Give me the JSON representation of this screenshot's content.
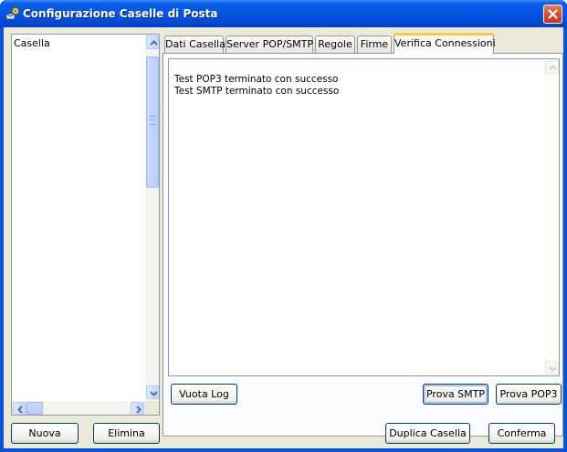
{
  "window": {
    "title": "Configurazione Caselle di Posta"
  },
  "list": {
    "header": "Casella"
  },
  "tabs": [
    {
      "label": "Dati Casella"
    },
    {
      "label": "Server POP/SMTP"
    },
    {
      "label": "Regole"
    },
    {
      "label": "Firme"
    },
    {
      "label": "Verifica Connessioni",
      "active": true
    }
  ],
  "log": {
    "lines": [
      "Test POP3 terminato con successo",
      "Test SMTP terminato con successo"
    ]
  },
  "panel_buttons": {
    "clear_log": "Vuota Log",
    "test_smtp": "Prova SMTP",
    "test_pop3": "Prova POP3"
  },
  "footer_buttons": {
    "new": "Nuova",
    "delete": "Elimina",
    "duplicate": "Duplica Casella",
    "confirm": "Conferma"
  },
  "icons": {
    "app": "mailbox-config-icon",
    "close": "close-icon"
  },
  "colors": {
    "title_bar": "#0456e3",
    "window_bg": "#ece9d8",
    "active_tab_accent": "#ffc83c",
    "close_button": "#d2452a"
  }
}
